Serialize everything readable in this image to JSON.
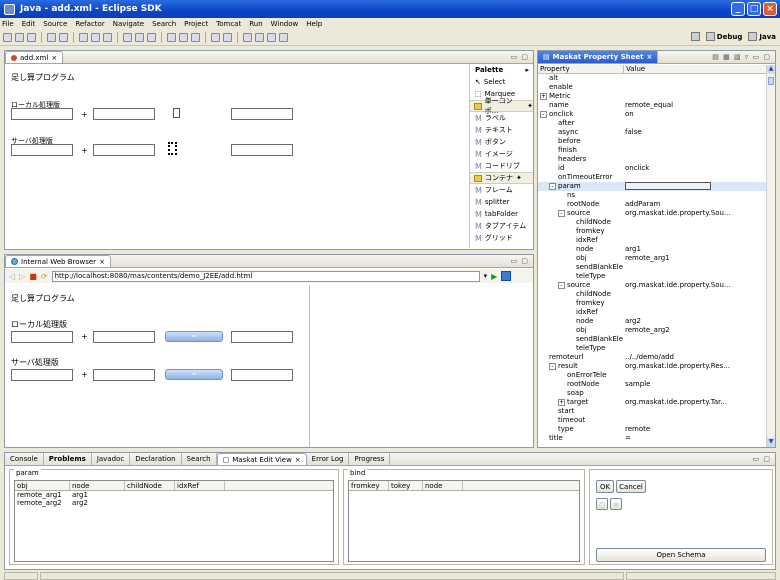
{
  "window": {
    "title": "Java - add.xml - Eclipse SDK",
    "controls": [
      "_",
      "□",
      "×"
    ]
  },
  "menu": [
    "File",
    "Edit",
    "Source",
    "Refactor",
    "Navigate",
    "Search",
    "Project",
    "Tomcat",
    "Run",
    "Window",
    "Help"
  ],
  "perspectives": {
    "debug": "Debug",
    "java": "Java"
  },
  "editor": {
    "tab": "add.xml",
    "title": "足し算プログラム",
    "local_label": "ローカル処理版",
    "server_label": "サーバ処理版",
    "plus": "+"
  },
  "palette": {
    "title": "Palette",
    "tools": [
      "Select",
      "Marquee"
    ],
    "group1": "単一コンポ...",
    "group1_items": [
      "ラベル",
      "テキスト",
      "ボタン",
      "イメージ",
      "コードリブ"
    ],
    "group2": "コンテナ",
    "group2_items": [
      "フレーム",
      "splitter",
      "tabFolder",
      "タブアイテム",
      "グリッド"
    ]
  },
  "browser": {
    "tab": "Internal Web Browser",
    "url": "http://localhost:8080/mas/contents/demo_J2EE/add.html",
    "title": "足し算プログラム",
    "local_label": "ローカル処理版",
    "server_label": "サーバ処理版",
    "plus": "+",
    "button_text": "="
  },
  "props": {
    "tab": "Maskat Property Sheet",
    "col_property": "Property",
    "col_value": "Value",
    "rows": [
      {
        "name": "alt",
        "value": "",
        "indent": 1
      },
      {
        "name": "enable",
        "value": "",
        "indent": 1
      },
      {
        "name": "Metric",
        "value": "",
        "indent": 0,
        "expander": "+"
      },
      {
        "name": "name",
        "value": "remote_equal",
        "indent": 1
      },
      {
        "name": "onclick",
        "value": "on",
        "indent": 0,
        "expander": "-"
      },
      {
        "name": "after",
        "value": "",
        "indent": 2
      },
      {
        "name": "async",
        "value": "false",
        "indent": 2
      },
      {
        "name": "before",
        "value": "",
        "indent": 2
      },
      {
        "name": "finish",
        "value": "",
        "indent": 2
      },
      {
        "name": "headers",
        "value": "",
        "indent": 2
      },
      {
        "name": "id",
        "value": "onclick",
        "indent": 2
      },
      {
        "name": "onTimeoutError",
        "value": "",
        "indent": 2
      },
      {
        "name": "param",
        "value": "",
        "indent": 1,
        "expander": "-",
        "highlight": true
      },
      {
        "name": "ns",
        "value": "",
        "indent": 3
      },
      {
        "name": "rootNode",
        "value": "addParam",
        "indent": 3
      },
      {
        "name": "source",
        "value": "org.maskat.ide.property.Sou...",
        "indent": 2,
        "expander": "-"
      },
      {
        "name": "childNode",
        "value": "",
        "indent": 4
      },
      {
        "name": "fromkey",
        "value": "",
        "indent": 4
      },
      {
        "name": "idxRef",
        "value": "",
        "indent": 4
      },
      {
        "name": "node",
        "value": "arg1",
        "indent": 4
      },
      {
        "name": "obj",
        "value": "remote_arg1",
        "indent": 4
      },
      {
        "name": "sendBlankEle",
        "value": "",
        "indent": 4
      },
      {
        "name": "teleType",
        "value": "",
        "indent": 4
      },
      {
        "name": "source",
        "value": "org.maskat.ide.property.Sou...",
        "indent": 2,
        "expander": "-"
      },
      {
        "name": "childNode",
        "value": "",
        "indent": 4
      },
      {
        "name": "fromkey",
        "value": "",
        "indent": 4
      },
      {
        "name": "idxRef",
        "value": "",
        "indent": 4
      },
      {
        "name": "node",
        "value": "arg2",
        "indent": 4
      },
      {
        "name": "obj",
        "value": "remote_arg2",
        "indent": 4
      },
      {
        "name": "sendBlankEle",
        "value": "",
        "indent": 4
      },
      {
        "name": "teleType",
        "value": "",
        "indent": 4
      },
      {
        "name": "remoteurl",
        "value": "../../demo/add",
        "indent": 1
      },
      {
        "name": "result",
        "value": "org.maskat.ide.property.Res...",
        "indent": 1,
        "expander": "-"
      },
      {
        "name": "onErrorTele",
        "value": "",
        "indent": 3
      },
      {
        "name": "rootNode",
        "value": "sample",
        "indent": 3
      },
      {
        "name": "soap",
        "value": "",
        "indent": 3
      },
      {
        "name": "target",
        "value": "org.maskat.ide.property.Tar...",
        "indent": 2,
        "expander": "+"
      },
      {
        "name": "start",
        "value": "",
        "indent": 2
      },
      {
        "name": "timeout",
        "value": "",
        "indent": 2
      },
      {
        "name": "type",
        "value": "remote",
        "indent": 2
      },
      {
        "name": "title",
        "value": "=",
        "indent": 1
      }
    ]
  },
  "bottom": {
    "tabs": [
      "Console",
      "Problems",
      "Javadoc",
      "Declaration",
      "Search",
      "Maskat Edit View",
      "Error Log",
      "Progress"
    ],
    "active_tab_index": 5,
    "param": {
      "label": "param",
      "columns": [
        "obj",
        "node",
        "childNode",
        "idxRef"
      ],
      "rows": [
        [
          "remote_arg1",
          "arg1",
          "",
          ""
        ],
        [
          "remote_arg2",
          "arg2",
          "",
          ""
        ]
      ]
    },
    "bind": {
      "label": "bind",
      "columns": [
        "fromkey",
        "tokey",
        "node"
      ]
    },
    "ok": "OK",
    "cancel": "Cancel",
    "open_schema": "Open Schema"
  }
}
